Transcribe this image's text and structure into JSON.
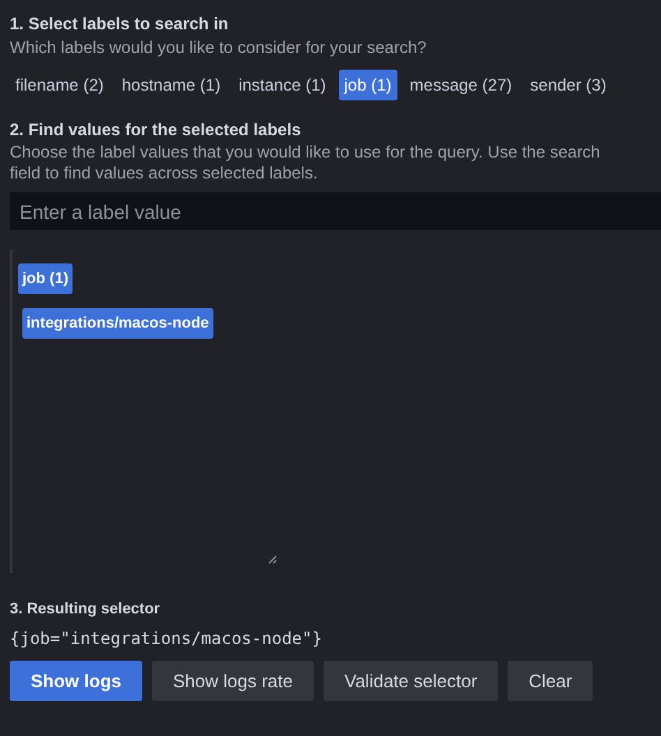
{
  "label_section": {
    "title": "1. Select labels to search in",
    "description": "Which labels would you like to consider for your search?",
    "labels": [
      {
        "label": "filename (2)",
        "selected": false
      },
      {
        "label": "hostname (1)",
        "selected": false
      },
      {
        "label": "instance (1)",
        "selected": false
      },
      {
        "label": "job (1)",
        "selected": true
      },
      {
        "label": "message (27)",
        "selected": false
      },
      {
        "label": "sender (3)",
        "selected": false
      }
    ]
  },
  "values_section": {
    "title": "2. Find values for the selected labels",
    "description": "Choose the label values that you would like to use for the query. Use the search field to find values across selected labels.",
    "search": {
      "placeholder": "Enter a label value"
    },
    "groups": [
      {
        "label": "job (1)",
        "values": [
          {
            "label": "integrations/macos-node",
            "selected": true
          }
        ]
      }
    ]
  },
  "selector_section": {
    "title": "3. Resulting selector",
    "selector": "{job=\"integrations/macos-node\"}"
  },
  "buttons": [
    {
      "label": "Show logs",
      "kind": "primary"
    },
    {
      "label": "Show logs rate",
      "kind": "secondary"
    },
    {
      "label": "Validate selector",
      "kind": "secondary"
    },
    {
      "label": "Clear",
      "kind": "secondary"
    }
  ]
}
